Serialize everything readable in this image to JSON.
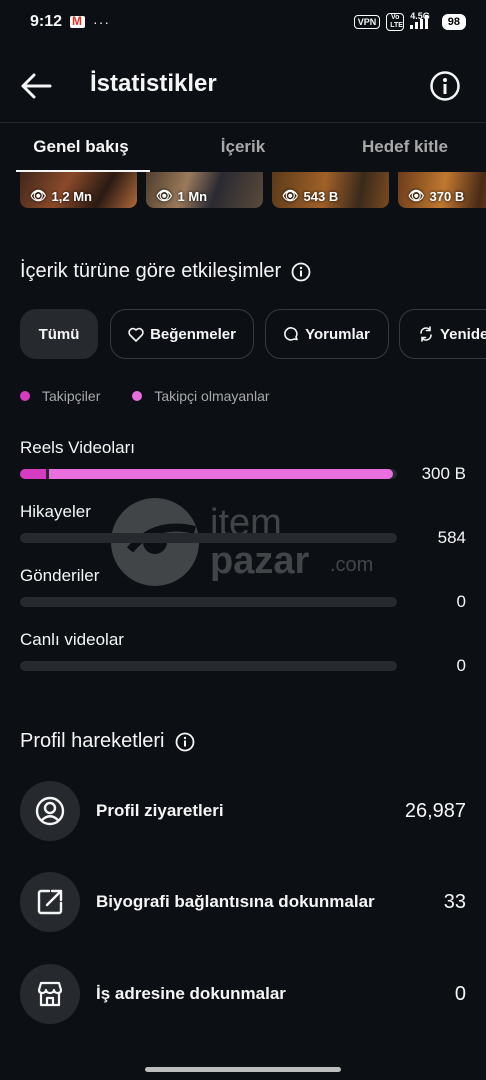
{
  "status_bar": {
    "time": "9:12",
    "dots": "···",
    "vpn": "VPN",
    "volte": "Vo LTE",
    "network": "4.5G",
    "battery": "98"
  },
  "header": {
    "title": "İstatistikler"
  },
  "tabs": [
    {
      "label": "Genel bakış",
      "active": true
    },
    {
      "label": "İçerik",
      "active": false
    },
    {
      "label": "Hedef kitle",
      "active": false
    }
  ],
  "thumbnails": [
    {
      "views": "1,2 Mn"
    },
    {
      "views": "1 Mn"
    },
    {
      "views": "543 B"
    },
    {
      "views": "370 B"
    }
  ],
  "interactions": {
    "title": "İçerik türüne göre etkileşimler",
    "filters": [
      {
        "label": "Tümü",
        "icon": "none",
        "active": true
      },
      {
        "label": "Beğenmeler",
        "icon": "heart-icon",
        "active": false
      },
      {
        "label": "Yorumlar",
        "icon": "comment-icon",
        "active": false
      },
      {
        "label": "Yeniden",
        "icon": "repost-icon",
        "active": false
      }
    ],
    "legend": [
      {
        "label": "Takipçiler",
        "color": "#d63cc1"
      },
      {
        "label": "Takipçi olmayanlar",
        "color": "#ea6fde"
      }
    ],
    "rows": [
      {
        "label": "Reels Videoları",
        "value": "300 B",
        "followers_fraction": 0.07,
        "non_followers_fraction": 0.92
      },
      {
        "label": "Hikayeler",
        "value": "584",
        "followers_fraction": 0,
        "non_followers_fraction": 0
      },
      {
        "label": "Gönderiler",
        "value": "0",
        "followers_fraction": 0,
        "non_followers_fraction": 0
      },
      {
        "label": "Canlı videolar",
        "value": "0",
        "followers_fraction": 0,
        "non_followers_fraction": 0
      }
    ]
  },
  "watermark": {
    "brand": "item",
    "brand2": "pazar",
    "suffix": ".com"
  },
  "profile_actions": {
    "title": "Profil hareketleri",
    "rows": [
      {
        "label": "Profil ziyaretleri",
        "value": "26,987",
        "icon": "user-circle-icon"
      },
      {
        "label": "Biyografi bağlantısına dokunmalar",
        "value": "33",
        "icon": "external-link-icon"
      },
      {
        "label": "İş adresine dokunmalar",
        "value": "0",
        "icon": "storefront-icon"
      }
    ]
  }
}
